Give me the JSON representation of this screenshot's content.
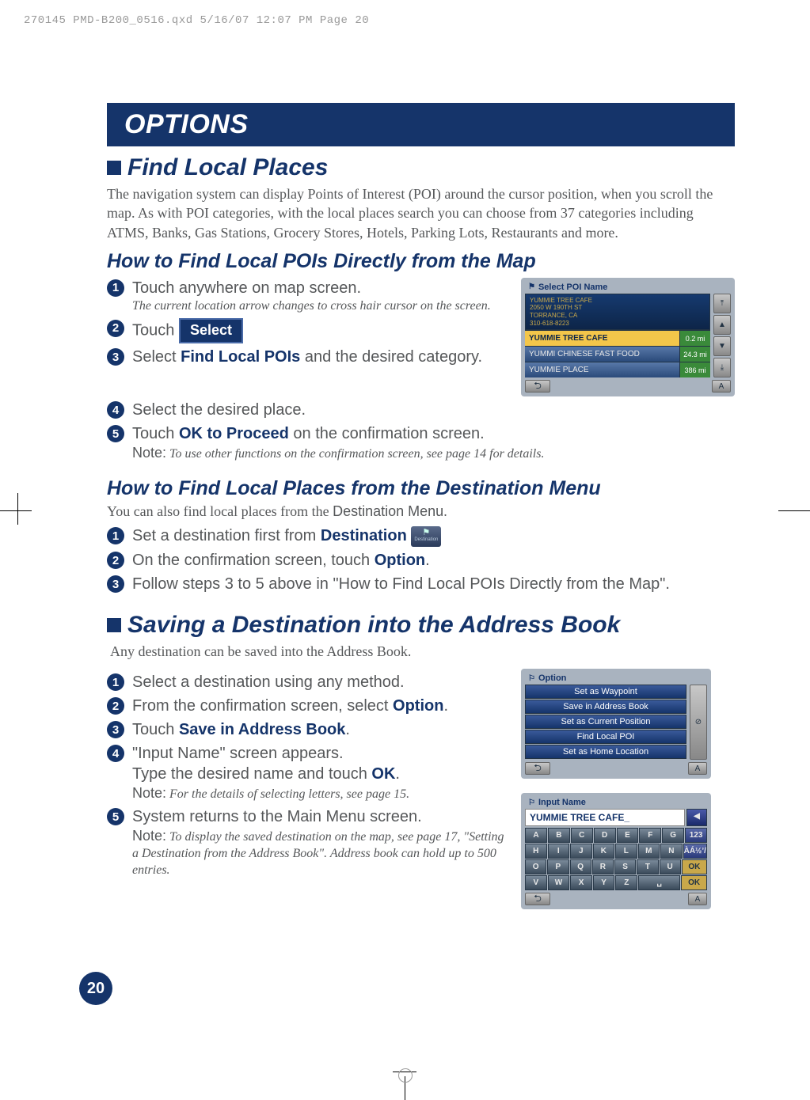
{
  "header": "270145 PMD-B200_0516.qxd  5/16/07  12:07 PM  Page 20",
  "banner": "OPTIONS",
  "page_number": "20",
  "find_local": {
    "title": "Find Local Places",
    "intro": "The navigation system can display Points of Interest (POI) around the cursor position, when you scroll the map. As with POI categories, with the local places search you can choose from 37 categories including ATMS, Banks, Gas Stations, Grocery Stores, Hotels, Parking Lots, Restaurants and more.",
    "sub1_title": "How to Find Local POIs Directly from the Map",
    "steps_a": {
      "s1": "Touch anywhere on map screen.",
      "s1_note": "The current location arrow changes to cross hair cursor on the screen.",
      "s2_pre": "Touch",
      "select_btn": "Select",
      "s3_pre": "Select ",
      "s3_link": "Find Local POIs",
      "s3_post": " and the desired category.",
      "s4": "Select the desired place.",
      "s5_pre": "Touch ",
      "s5_link": "OK to Proceed",
      "s5_post": " on the confirmation screen.",
      "s5_note_label": "Note:",
      "s5_note": " To use other functions on the confirmation screen, see page 14 for details."
    },
    "sub2_title": "How to Find Local Places from the Destination Menu",
    "sub2_intro_a": "You can also find local places from the ",
    "sub2_intro_b": "Destination Menu",
    "sub2_intro_c": ".",
    "steps_b": {
      "s1_pre": "Set a destination first from ",
      "s1_link": "Destination",
      "s2_pre": "On the confirmation screen, touch ",
      "s2_link": "Option",
      "s2_post": ".",
      "s3": "Follow steps 3 to 5 above in \"How to Find Local POIs Directly from the Map\"."
    }
  },
  "saving": {
    "title": "Saving a Destination into the Address Book",
    "intro": "Any destination can be saved into the Address Book.",
    "s1": "Select a destination using any method.",
    "s2_pre": "From the confirmation screen, select ",
    "s2_link": "Option",
    "s2_post": ".",
    "s3_pre": "Touch ",
    "s3_link": "Save in Address Book",
    "s3_post": ".",
    "s4_a": "\"Input Name\" screen appears.",
    "s4_b_pre": "Type the desired name and touch ",
    "s4_b_link": "OK",
    "s4_b_post": ".",
    "s4_note_label": "Note:",
    "s4_note": " For the details of selecting letters, see page 15.",
    "s5": "System returns to the Main Menu screen.",
    "s5_note_label": "Note:",
    "s5_note": " To display the saved destination on the map, see page 17, \"Setting a Destination from the Address Book\". Address book can hold up to 500 entries."
  },
  "poi_screen": {
    "title": "Select POI Name",
    "detail_l1": "YUMMIE TREE CAFE",
    "detail_l2": "2050 W 190TH ST",
    "detail_l3": "TORRANCE, CA",
    "detail_l4": "310-618-8223",
    "rows": [
      {
        "name": "YUMMIE TREE CAFE",
        "dist": "0.2 mi",
        "hl": true
      },
      {
        "name": "YUMMI CHINESE FAST FOOD",
        "dist": "24.3 mi",
        "hl": false
      },
      {
        "name": "YUMMIE PLACE",
        "dist": "386 mi",
        "hl": false
      }
    ]
  },
  "option_screen": {
    "title": "Option",
    "items": [
      "Set as Waypoint",
      "Save in Address Book",
      "Set as Current Position",
      "Find Local POI",
      "Set as Home Location"
    ]
  },
  "input_screen": {
    "title": "Input Name",
    "value": "YUMMIE TREE CAFE_",
    "row1": [
      "A",
      "B",
      "C",
      "D",
      "E",
      "F",
      "G"
    ],
    "row1_num": "123",
    "row2": [
      "H",
      "I",
      "J",
      "K",
      "L",
      "M",
      "N"
    ],
    "row2_sym": "ÀÁ½ʼ/",
    "row3": [
      "O",
      "P",
      "Q",
      "R",
      "S",
      "T",
      "U"
    ],
    "row4": [
      "V",
      "W",
      "X",
      "Y",
      "Z"
    ],
    "ok": "OK"
  }
}
